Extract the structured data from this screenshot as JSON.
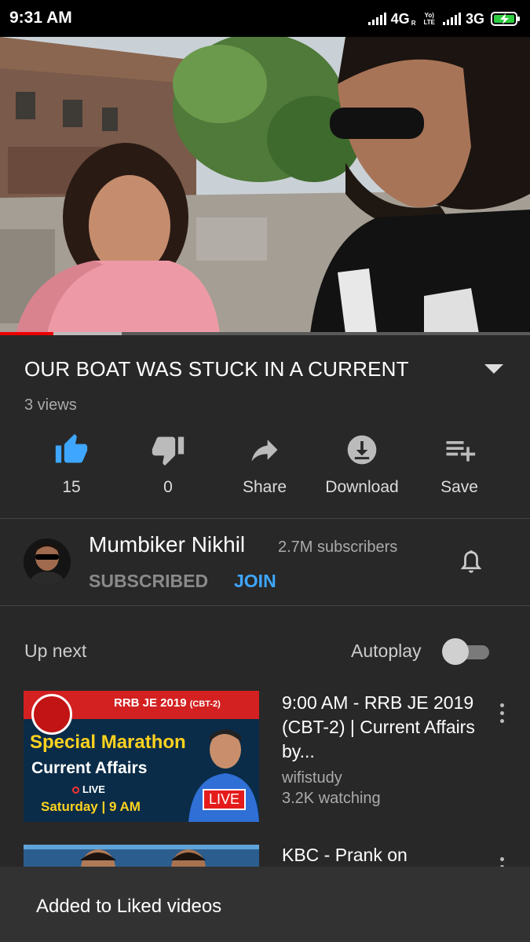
{
  "status_bar": {
    "time": "9:31 AM",
    "network1": "4G",
    "network1_sup": "R",
    "lte_line1": "Yo)",
    "lte_line2": "LTE",
    "network2": "3G"
  },
  "video": {
    "progress_fraction": 0.1,
    "buffered_fraction": 0.23,
    "title": "OUR BOAT WAS STUCK IN A CURRENT",
    "views": "3 views"
  },
  "actions": [
    {
      "icon": "thumbs-up-icon",
      "label": "15",
      "active": true
    },
    {
      "icon": "thumbs-down-icon",
      "label": "0",
      "active": false
    },
    {
      "icon": "share-icon",
      "label": "Share",
      "active": false
    },
    {
      "icon": "download-icon",
      "label": "Download",
      "active": false
    },
    {
      "icon": "playlist-add-icon",
      "label": "Save",
      "active": false
    }
  ],
  "channel": {
    "name": "Mumbiker Nikhil",
    "subscribers": "2.7M subscribers",
    "subscribed_label": "SUBSCRIBED",
    "join_label": "JOIN"
  },
  "up_next": {
    "label": "Up next",
    "autoplay_label": "Autoplay",
    "autoplay_on": false
  },
  "videos": [
    {
      "title": "9:00 AM - RRB JE 2019 (CBT-2) | Current Affairs by...",
      "channel": "wifistudy",
      "meta": "3.2K watching",
      "thumbnail": {
        "tag": "RRB JE 2019",
        "tag_small": "(CBT-2)",
        "heading": "Special Marathon",
        "subheading": "Current Affairs",
        "live_text": "LIVE",
        "schedule": "Saturday | 9 AM",
        "badge": "LIVE"
      }
    },
    {
      "title": "KBC - Prank on"
    }
  ],
  "snackbar": {
    "text": "Added to Liked videos"
  },
  "colors": {
    "background": "#282828",
    "accent_blue": "#3ea6ff",
    "progress_red": "#ee0000",
    "like_active": "#3ea6ff"
  }
}
